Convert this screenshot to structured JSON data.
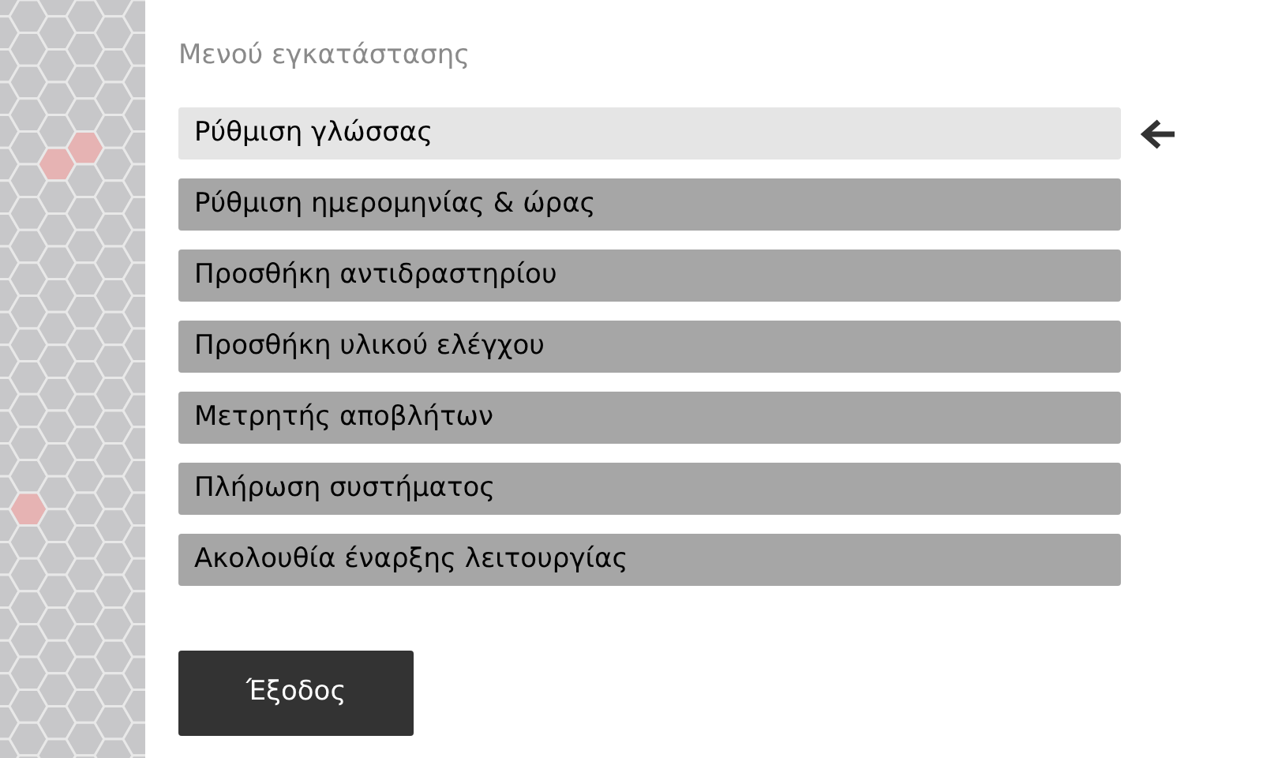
{
  "title": "Μενού εγκατάστασης",
  "menu_items": [
    {
      "label": "Ρύθμιση γλώσσας",
      "selected": true
    },
    {
      "label": "Ρύθμιση ημερομηνίας & ώρας",
      "selected": false
    },
    {
      "label": "Προσθήκη αντιδραστηρίου",
      "selected": false
    },
    {
      "label": "Προσθήκη υλικού ελέγχου",
      "selected": false
    },
    {
      "label": "Μετρητής αποβλήτων",
      "selected": false
    },
    {
      "label": "Πλήρωση συστήματος",
      "selected": false
    },
    {
      "label": "Ακολουθία έναρξης λειτουργίας",
      "selected": false
    }
  ],
  "exit_button": {
    "label": "Έξοδος"
  }
}
